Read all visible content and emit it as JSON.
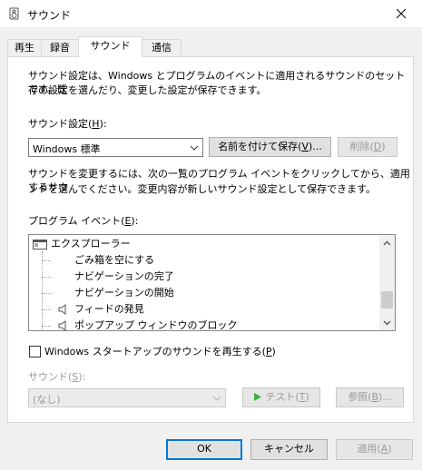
{
  "window": {
    "title": "サウンド",
    "close_glyph": "✕"
  },
  "tabs": [
    {
      "label": "再生"
    },
    {
      "label": "録音"
    },
    {
      "label": "サウンド"
    },
    {
      "label": "通信"
    }
  ],
  "intro": {
    "line1": "サウンド設定は、Windows とプログラムのイベントに適用されるサウンドのセットです。既",
    "line2": "存の設定を選んだり、変更した設定が保存できます。"
  },
  "scheme": {
    "label_main": "サウンド設定(",
    "label_key": "H",
    "label_end": "):",
    "value": "Windows 標準",
    "save_label_main": "名前を付けて保存(",
    "save_label_key": "V",
    "save_label_end": ")...",
    "delete_label_main": "削除(",
    "delete_label_key": "D",
    "delete_label_end": ")"
  },
  "instructions": {
    "line1": "サウンドを変更するには、次の一覧のプログラム イベントをクリックしてから、適用するサウ",
    "line2": "ンドを選んでください。変更内容が新しいサウンド設定として保存できます。"
  },
  "events": {
    "label_main": "プログラム イベント(",
    "label_key": "E",
    "label_end": "):",
    "items": [
      {
        "label": "エクスプローラー",
        "kind": "group"
      },
      {
        "label": "ごみ箱を空にする",
        "kind": "item"
      },
      {
        "label": "ナビゲーションの完了",
        "kind": "item"
      },
      {
        "label": "ナビゲーションの開始",
        "kind": "item"
      },
      {
        "label": "フィードの発見",
        "kind": "sound"
      },
      {
        "label": "ポップアップ ウィンドウのブロック",
        "kind": "sound"
      }
    ]
  },
  "startup": {
    "label_main": "Windows スタートアップのサウンドを再生する(",
    "label_key": "P",
    "label_end": ")",
    "checked": false
  },
  "sounds": {
    "label_main": "サウンド(",
    "label_key": "S",
    "label_end": "):",
    "value": "(なし)",
    "test_label_main": "テスト(",
    "test_label_key": "T",
    "test_label_end": ")",
    "browse_label_main": "参照(",
    "browse_label_key": "B",
    "browse_label_end": ")..."
  },
  "footer": {
    "ok_label": "OK",
    "cancel_label": "キャンセル",
    "apply_label_main": "適用(",
    "apply_label_key": "A",
    "apply_label_end": ")"
  },
  "colors": {
    "accent": "#0078d7",
    "disabled_text": "#9a9a9a",
    "test_play": "#3cb043"
  }
}
